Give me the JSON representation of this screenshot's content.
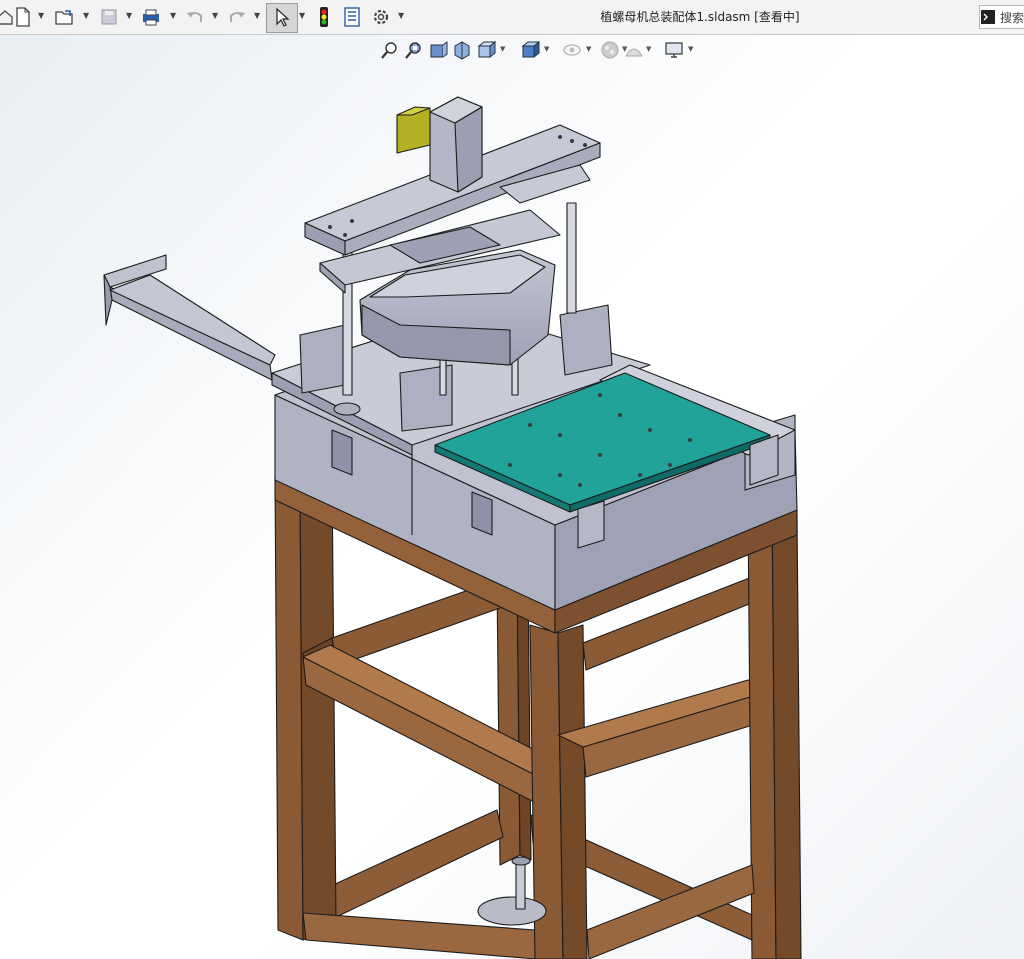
{
  "toolbar": {
    "icons": [
      "home-icon",
      "new-document-icon",
      "open-icon",
      "save-icon",
      "print-icon",
      "undo-icon",
      "redo-icon",
      "select-icon",
      "rebuild-icon",
      "file-properties-icon",
      "options-icon"
    ]
  },
  "window": {
    "title": "植螺母机总装配体1.sldasm [查看中]"
  },
  "search": {
    "label": "搜索"
  },
  "heads_up_toolbar": {
    "icons": [
      "zoom-to-fit-icon",
      "zoom-to-area-icon",
      "previous-view-icon",
      "section-view-icon",
      "view-orientation-icon",
      "display-style-icon",
      "hide-show-icon",
      "edit-appearance-icon",
      "apply-scene-icon",
      "view-settings-icon"
    ]
  },
  "colors": {
    "wood_frame": "#8a5a34",
    "metal": "#a5a8b8",
    "teal_plate": "#21a39a",
    "yellow_motor": "#b3b024"
  }
}
